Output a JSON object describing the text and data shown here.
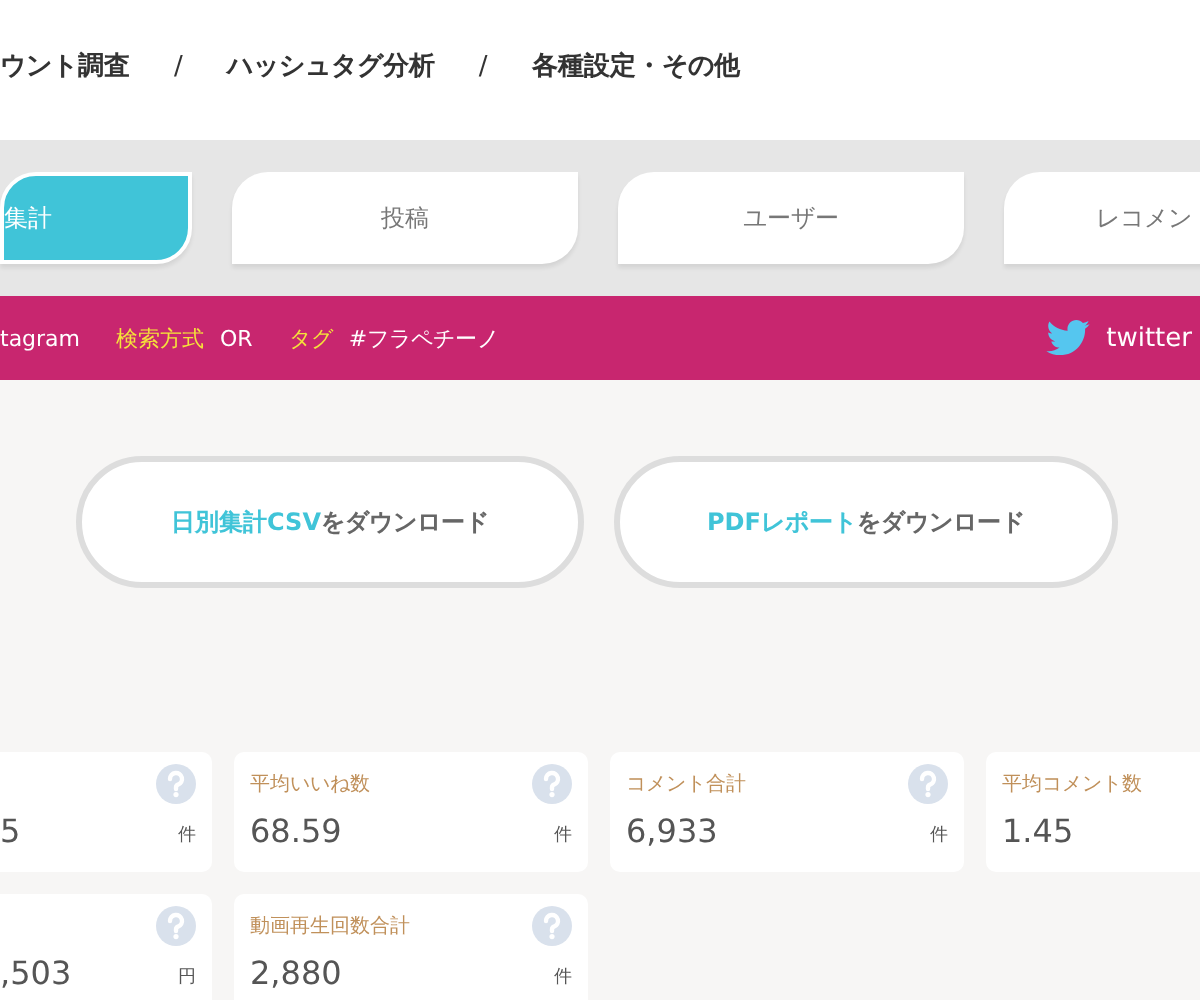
{
  "breadcrumb": [
    {
      "kind": "link",
      "text": "ウント調査"
    },
    {
      "kind": "separator",
      "text": "/"
    },
    {
      "kind": "link",
      "text": "ハッシュタグ分析"
    },
    {
      "kind": "separator",
      "text": "/"
    },
    {
      "kind": "link",
      "text": "各種設定・その他"
    }
  ],
  "tabs": [
    {
      "label": "集計",
      "selected": true
    },
    {
      "label": "投稿",
      "selected": false
    },
    {
      "label": "ユーザー",
      "selected": false
    },
    {
      "label": "レコメン",
      "selected": false
    }
  ],
  "filter_bar": {
    "items": [
      {
        "kind": "value",
        "text": "tagram"
      },
      {
        "kind": "label",
        "text": "検索方式"
      },
      {
        "kind": "value",
        "text": "OR"
      },
      {
        "kind": "label",
        "text": "タグ"
      },
      {
        "kind": "value",
        "text": "#フラペチーノ"
      }
    ],
    "twitter_link": "twitter"
  },
  "downloads": [
    {
      "highlight": "日別集計CSV",
      "rest": "をダウンロード"
    },
    {
      "highlight": "PDFレポート",
      "rest": "をダウンロード"
    }
  ],
  "stat_rows": [
    [
      {
        "value": "5",
        "unit": "件",
        "help_icon": true
      },
      {
        "label": "平均いいね数",
        "value": "68.59",
        "unit": "件",
        "help_icon": true
      },
      {
        "label": "コメント合計",
        "value": "6,933",
        "unit": "件",
        "help_icon": true
      },
      {
        "label": "平均コメント数",
        "value": "1.45"
      }
    ],
    [
      {
        "value": ",503",
        "unit": "円",
        "help_icon": true
      },
      {
        "label": "動画再生回数合計",
        "value": "2,880",
        "unit": "件",
        "help_icon": true
      }
    ]
  ]
}
